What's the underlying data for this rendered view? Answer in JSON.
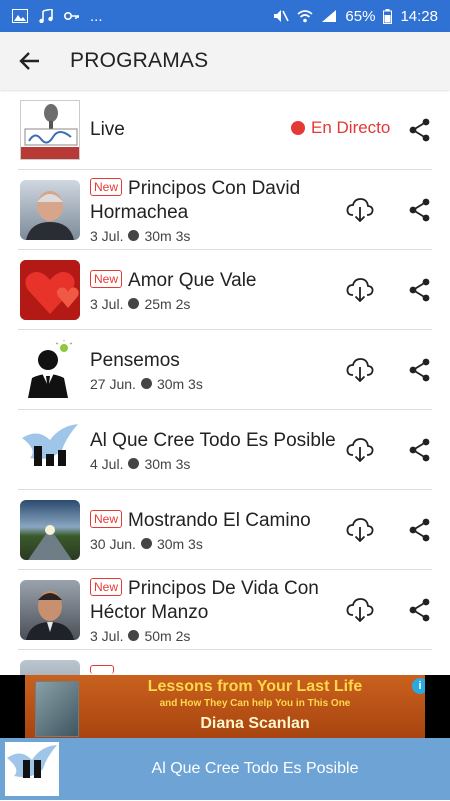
{
  "status_bar": {
    "left_icons": [
      "image-icon",
      "music-icon",
      "key-icon"
    ],
    "ellipsis": "...",
    "battery": "65%",
    "time": "14:28"
  },
  "app_bar": {
    "title": "PROGRAMAS"
  },
  "live": {
    "title": "Live",
    "status": "En Directo"
  },
  "items": [
    {
      "title": "Principos Con David Hormachea",
      "badge": "New",
      "date": "3 Jul.",
      "duration": "30m 3s"
    },
    {
      "title": "Amor Que Vale",
      "badge": "New",
      "date": "3 Jul.",
      "duration": "25m 2s"
    },
    {
      "title": "Pensemos",
      "badge": "",
      "date": "27 Jun.",
      "duration": "30m 3s"
    },
    {
      "title": "Al Que Cree Todo Es Posible",
      "badge": "",
      "date": "4 Jul.",
      "duration": "30m 3s"
    },
    {
      "title": "Mostrando El Camino",
      "badge": "New",
      "date": "30 Jun.",
      "duration": "30m 3s"
    },
    {
      "title": "Principos De Vida Con Héctor Manzo",
      "badge": "New",
      "date": "3 Jul.",
      "duration": "50m 2s"
    }
  ],
  "ad": {
    "line1": "Lessons from Your Last Life",
    "line2": "and How They Can help You in This One",
    "line3": "Diana Scanlan",
    "info": "i",
    "close": "✕"
  },
  "player": {
    "now_playing": "Al Que Cree Todo Es Posible"
  },
  "colors": {
    "status_bar": "#2f72d3",
    "live_red": "#e53935",
    "player_bg": "#6ea3d6"
  }
}
